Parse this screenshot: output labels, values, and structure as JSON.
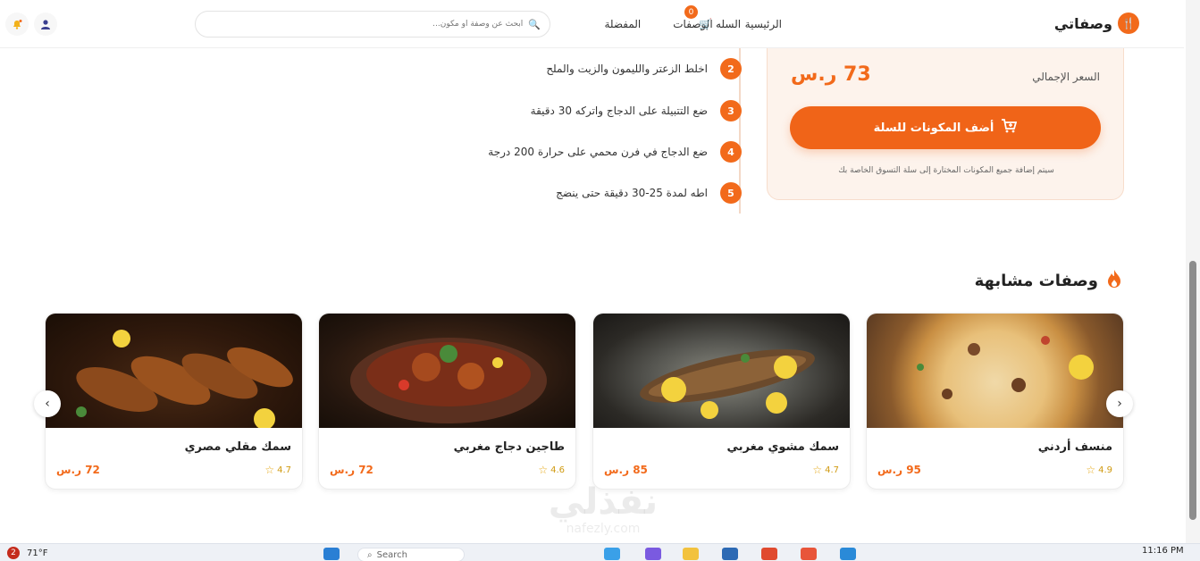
{
  "header": {
    "logo_text": "وصفاتي",
    "nav": [
      "الرئيسية",
      "الوصفات",
      "المفضلة"
    ],
    "cart_label": "السله",
    "cart_count": "0",
    "search_placeholder": "ابحث عن وصفة أو مكون..."
  },
  "steps": [
    {
      "num": "2",
      "text": "اخلط الزعتر والليمون والزيت والملح"
    },
    {
      "num": "3",
      "text": "ضع التتبيلة على الدجاج واتركه 30 دقيقة"
    },
    {
      "num": "4",
      "text": "ضع الدجاج في فرن محمي على حرارة 200 درجة"
    },
    {
      "num": "5",
      "text": "اطه لمدة 25-30 دقيقة حتى ينضج"
    }
  ],
  "price_panel": {
    "label": "السعر الإجمالي",
    "value": "73 ر.س",
    "button": "أضف المكونات للسلة",
    "note": "سيتم إضافة جميع المكونات المختارة إلى سلة التسوق الخاصة بك"
  },
  "similar": {
    "title": "وصفات مشابهة",
    "cards": [
      {
        "name": "منسف أردني",
        "rating": "4.9",
        "price": "95 ر.س"
      },
      {
        "name": "سمك مشوي مغربي",
        "rating": "4.7",
        "price": "85 ر.س"
      },
      {
        "name": "طاجين دجاج مغربي",
        "rating": "4.6",
        "price": "72 ر.س"
      },
      {
        "name": "سمك مقلي مصري",
        "rating": "4.7",
        "price": "72 ر.س"
      }
    ]
  },
  "watermark": {
    "ar": "نفذلي",
    "en": "nafezly.com"
  },
  "taskbar": {
    "weather_badge": "2",
    "temperature": "71°F",
    "search": "Search",
    "time": "11:16 PM"
  }
}
